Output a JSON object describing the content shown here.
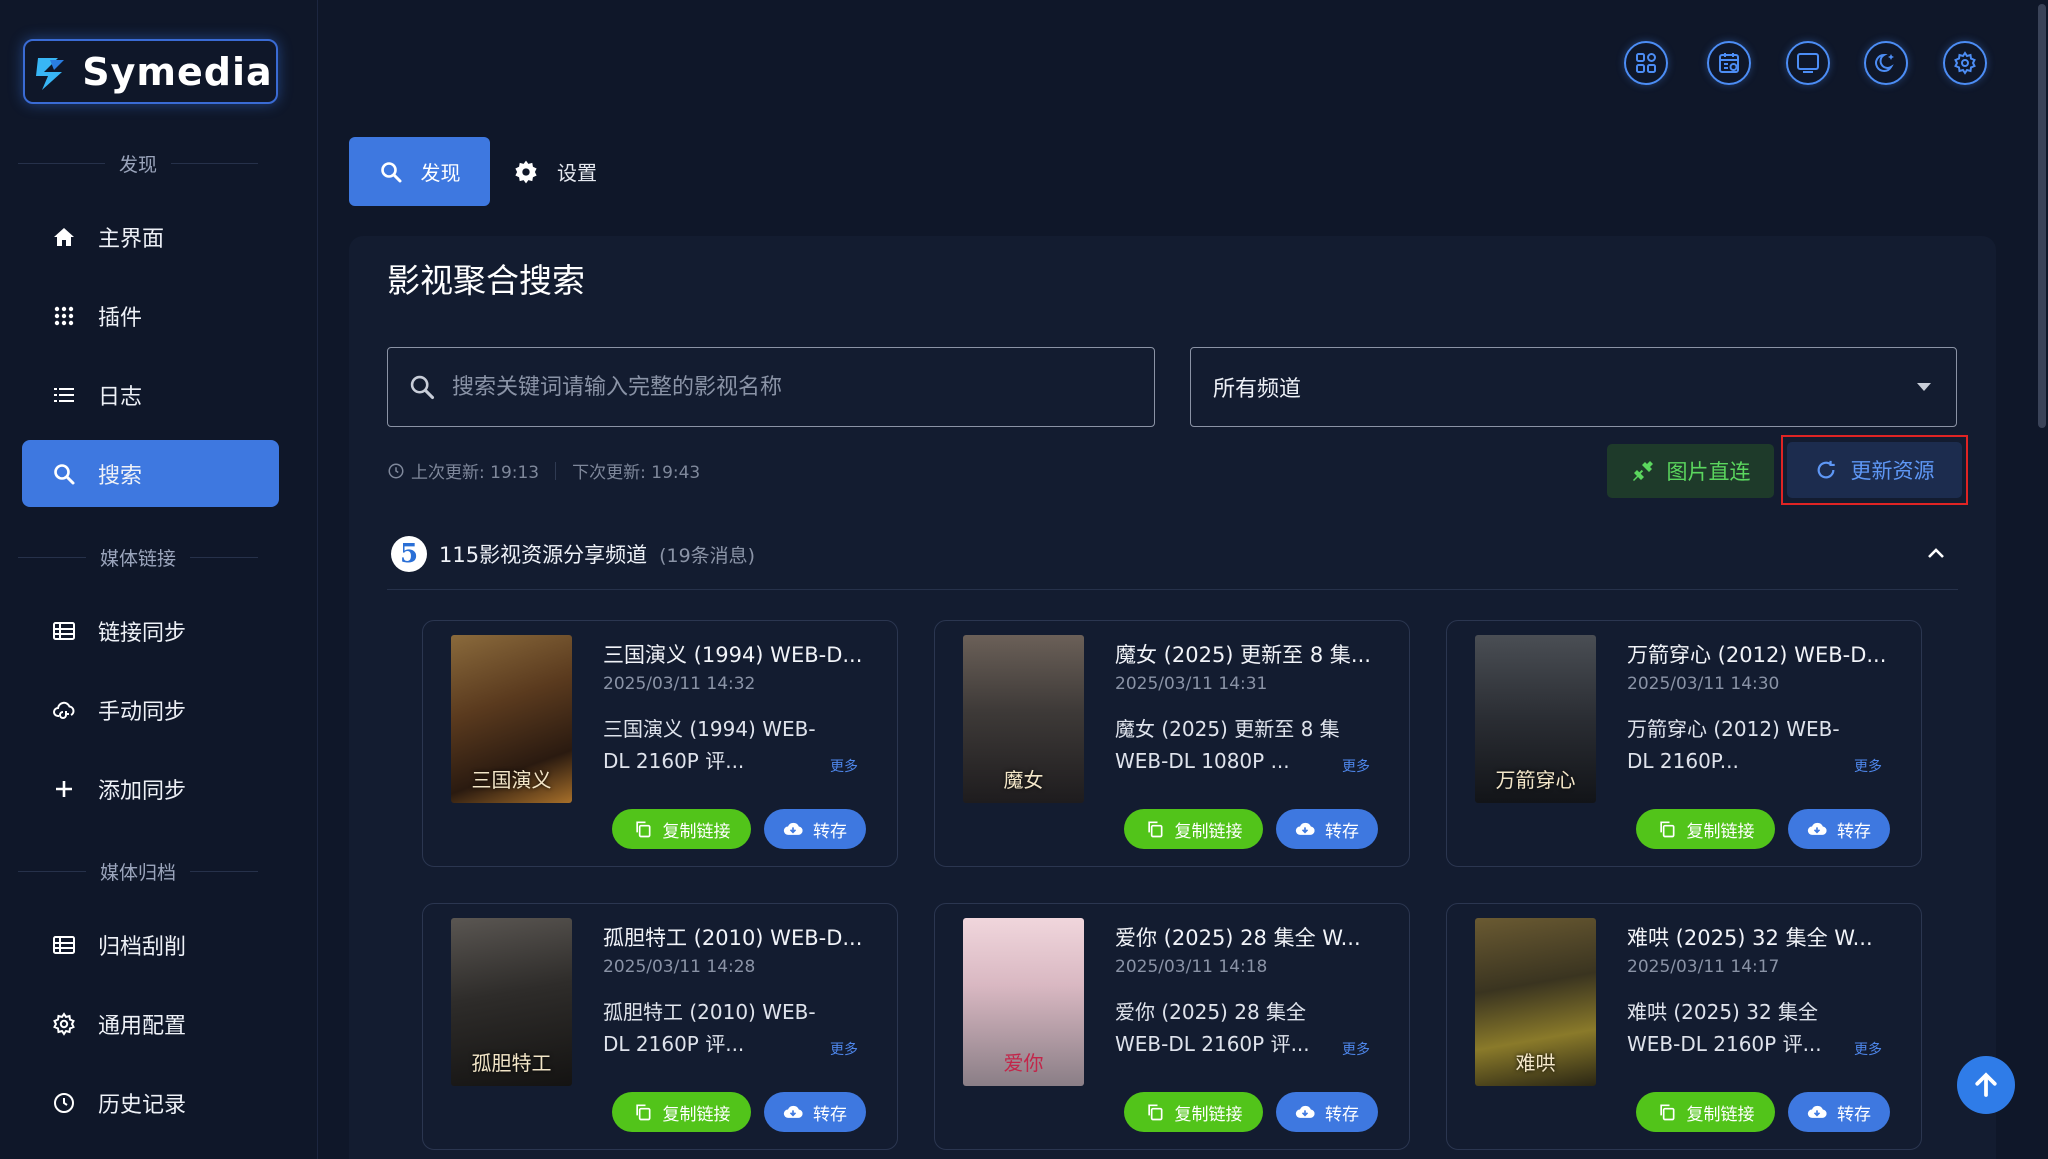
{
  "app": {
    "logo_text": "Symedia"
  },
  "sidebar": {
    "sections": [
      {
        "label": "发现"
      },
      {
        "label": "媒体链接"
      },
      {
        "label": "媒体归档"
      }
    ],
    "items": [
      {
        "label": "主界面",
        "icon": "home-icon"
      },
      {
        "label": "插件",
        "icon": "grid-icon"
      },
      {
        "label": "日志",
        "icon": "list-icon"
      },
      {
        "label": "搜索",
        "icon": "search-icon",
        "active": true
      },
      {
        "label": "链接同步",
        "icon": "table-icon"
      },
      {
        "label": "手动同步",
        "icon": "cloud-sync-icon"
      },
      {
        "label": "添加同步",
        "icon": "plus-icon"
      },
      {
        "label": "归档刮削",
        "icon": "table-icon"
      },
      {
        "label": "通用配置",
        "icon": "gear-icon"
      },
      {
        "label": "历史记录",
        "icon": "clock-icon"
      }
    ]
  },
  "topbar": {
    "icons": [
      "apps-icon",
      "calendar-icon",
      "monitor-icon",
      "theme-moon-icon",
      "settings-icon"
    ]
  },
  "tabs": [
    {
      "label": "发现",
      "icon": "search-icon",
      "active": true
    },
    {
      "label": "设置",
      "icon": "gear-icon"
    }
  ],
  "main": {
    "title": "影视聚合搜索",
    "search": {
      "placeholder": "搜索关键词请输入完整的影视名称",
      "value": ""
    },
    "channel_select": {
      "selected": "所有频道"
    },
    "update_info": {
      "last": "上次更新: 19:13",
      "next": "下次更新: 19:43"
    },
    "buttons": {
      "image_direct": "图片直连",
      "refresh": "更新资源"
    },
    "channel": {
      "badge": "5",
      "name": "115影视资源分享频道",
      "count": "(19条消息)"
    },
    "card_labels": {
      "more": "更多",
      "copy": "复制链接",
      "save": "转存"
    },
    "cards": [
      {
        "title": "三国演义 (1994) WEB-D...",
        "date": "2025/03/11 14:32",
        "desc": "三国演义 (1994) WEB-DL 2160P 评...",
        "poster_text": "三国演义"
      },
      {
        "title": "魔女 (2025) 更新至 8 集...",
        "date": "2025/03/11 14:31",
        "desc": "魔女 (2025) 更新至 8 集 WEB-DL 1080P ...",
        "poster_text": "魔女"
      },
      {
        "title": "万箭穿心 (2012) WEB-D...",
        "date": "2025/03/11 14:30",
        "desc": "万箭穿心 (2012) WEB-DL 2160P...",
        "poster_text": "万箭穿心"
      },
      {
        "title": "孤胆特工 (2010) WEB-D...",
        "date": "2025/03/11 14:28",
        "desc": "孤胆特工 (2010) WEB-DL 2160P 评...",
        "poster_text": "孤胆特工"
      },
      {
        "title": "爱你 (2025) 28 集全 W...",
        "date": "2025/03/11 14:18",
        "desc": "爱你 (2025) 28 集全 WEB-DL 2160P 评...",
        "poster_text": "爱你"
      },
      {
        "title": "难哄 (2025) 32 集全 W...",
        "date": "2025/03/11 14:17",
        "desc": "难哄 (2025) 32 集全 WEB-DL 2160P 评...",
        "poster_text": "难哄"
      }
    ]
  },
  "colors": {
    "accent": "#3e78e0",
    "green": "#52c41a",
    "background": "#0f1729",
    "highlight": "#e02424"
  }
}
